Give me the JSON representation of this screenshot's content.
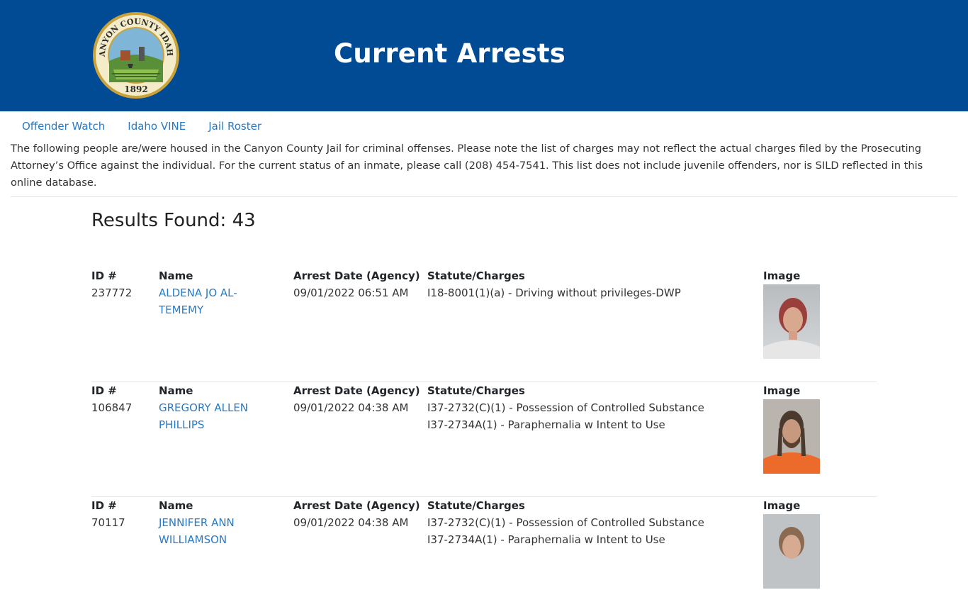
{
  "header": {
    "title": "Current Arrests",
    "seal_text_top": "CANYON COUNTY IDAHO",
    "seal_year": "1892",
    "bg_color": "#004b93"
  },
  "nav": {
    "links": [
      {
        "label": "Offender Watch"
      },
      {
        "label": "Idaho VINE"
      },
      {
        "label": "Jail Roster"
      }
    ]
  },
  "intro": "The following people are/were housed in the Canyon County Jail for criminal offenses. Please note the list of charges may not reflect the actual charges filed by the Prosecuting Attorney’s Office against the individual. For the current status of an inmate, please call (208) 454-7541. This list does not include juvenile offenders, nor is SILD reflected in this online database.",
  "results": {
    "label": "Results Found: 43"
  },
  "columns": {
    "id": "ID #",
    "name": "Name",
    "date": "Arrest Date (Agency)",
    "charges": "Statute/Charges",
    "image": "Image"
  },
  "records": [
    {
      "id": "237772",
      "name_line1": "ALDENA JO AL-",
      "name_line2": "TEMEMY",
      "date": "09/01/2022 06:51 AM",
      "charge1": "I18-8001(1)(a) - Driving without privileges-DWP",
      "charge2": "",
      "photo_shirt": "#e8e8e8"
    },
    {
      "id": "106847",
      "name_line1": "GREGORY ALLEN",
      "name_line2": "PHILLIPS",
      "date": "09/01/2022 04:38 AM",
      "charge1": "I37-2732(C)(1) - Possession of Controlled Substance",
      "charge2": "I37-2734A(1) - Paraphernalia w Intent to Use",
      "photo_shirt": "#ec6a2a"
    },
    {
      "id": "70117",
      "name_line1": "JENNIFER ANN",
      "name_line2": "WILLIAMSON",
      "date": "09/01/2022 04:38 AM",
      "charge1": "I37-2732(C)(1) - Possession of Controlled Substance",
      "charge2": "I37-2734A(1) - Paraphernalia w Intent to Use",
      "photo_shirt": "#d9d9d9"
    }
  ]
}
